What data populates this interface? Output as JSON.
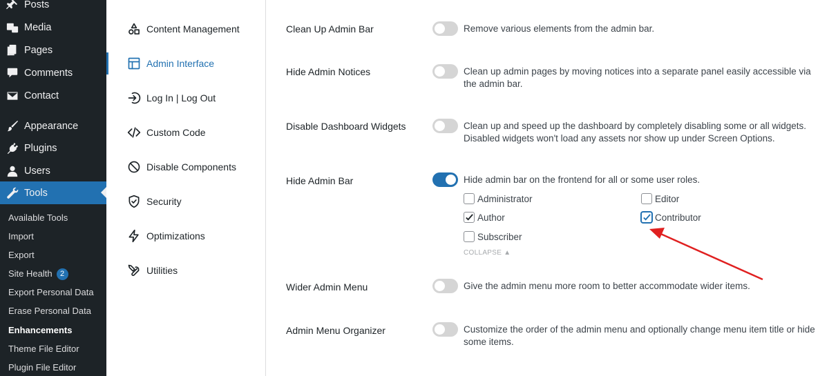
{
  "sidebar": {
    "items": [
      {
        "label": "Posts",
        "icon": "pin-icon"
      },
      {
        "label": "Media",
        "icon": "media-icon"
      },
      {
        "label": "Pages",
        "icon": "pages-icon"
      },
      {
        "label": "Comments",
        "icon": "comment-icon"
      },
      {
        "label": "Contact",
        "icon": "mail-icon"
      },
      {
        "label": "Appearance",
        "icon": "brush-icon"
      },
      {
        "label": "Plugins",
        "icon": "plug-icon"
      },
      {
        "label": "Users",
        "icon": "user-icon"
      },
      {
        "label": "Tools",
        "icon": "wrench-icon"
      }
    ],
    "submenu": [
      {
        "label": "Available Tools"
      },
      {
        "label": "Import"
      },
      {
        "label": "Export"
      },
      {
        "label": "Site Health",
        "badge": "2"
      },
      {
        "label": "Export Personal Data"
      },
      {
        "label": "Erase Personal Data"
      },
      {
        "label": "Enhancements"
      },
      {
        "label": "Theme File Editor"
      },
      {
        "label": "Plugin File Editor"
      }
    ]
  },
  "plugin_nav": {
    "items": [
      {
        "label": "Content Management",
        "icon": "shapes-icon"
      },
      {
        "label": "Admin Interface",
        "icon": "layout-icon"
      },
      {
        "label": "Log In | Log Out",
        "icon": "login-icon"
      },
      {
        "label": "Custom Code",
        "icon": "code-icon"
      },
      {
        "label": "Disable Components",
        "icon": "ban-icon"
      },
      {
        "label": "Security",
        "icon": "shield-icon"
      },
      {
        "label": "Optimizations",
        "icon": "bolt-icon"
      },
      {
        "label": "Utilities",
        "icon": "tools-icon"
      }
    ]
  },
  "settings": {
    "rows": [
      {
        "label": "Clean Up Admin Bar",
        "enabled": false,
        "description": "Remove various elements from the admin bar."
      },
      {
        "label": "Hide Admin Notices",
        "enabled": false,
        "description": "Clean up admin pages by moving notices into a separate panel easily accessible via the admin bar."
      },
      {
        "label": "Disable Dashboard Widgets",
        "enabled": false,
        "description": "Clean up and speed up the dashboard by completely disabling some or all widgets. Disabled widgets won't load any assets nor show up under Screen Options."
      },
      {
        "label": "Hide Admin Bar",
        "enabled": true,
        "description": "Hide admin bar on the frontend for all or some user roles."
      },
      {
        "label": "Wider Admin Menu",
        "enabled": false,
        "description": "Give the admin menu more room to better accommodate wider items."
      },
      {
        "label": "Admin Menu Organizer",
        "enabled": false,
        "description": "Customize the order of the admin menu and optionally change menu item title or hide some items."
      }
    ],
    "roles": [
      {
        "label": "Administrator",
        "checked": false
      },
      {
        "label": "Editor",
        "checked": false
      },
      {
        "label": "Author",
        "checked": true
      },
      {
        "label": "Contributor",
        "checked": true
      },
      {
        "label": "Subscriber",
        "checked": false
      }
    ],
    "collapse_label": "COLLAPSE ▲"
  },
  "colors": {
    "accent": "#2271b1",
    "sidebar_bg": "#1d2327",
    "annotation": "#e02020"
  }
}
